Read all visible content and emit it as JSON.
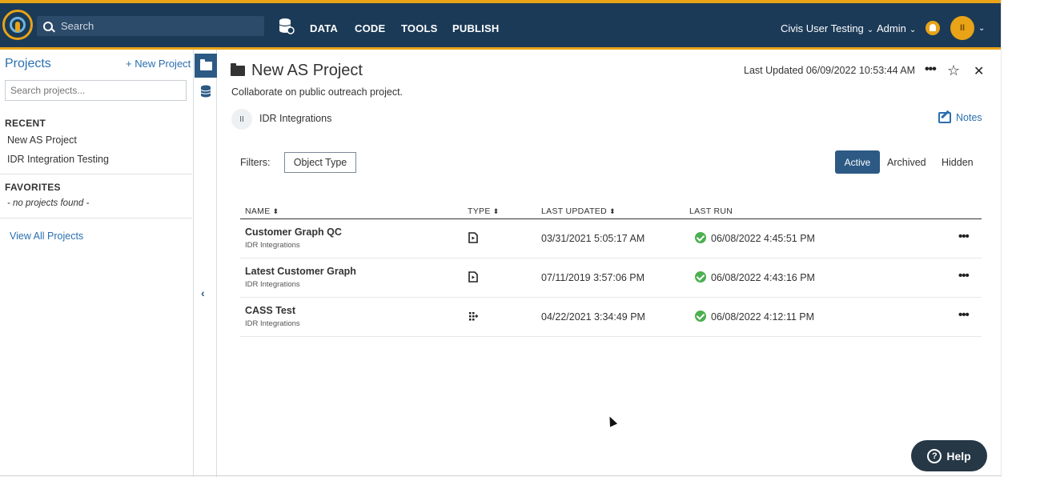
{
  "topbar": {
    "search_placeholder": "Search",
    "nav": [
      "DATA",
      "CODE",
      "TOOLS",
      "PUBLISH"
    ],
    "org_name": "Civis User Testing",
    "admin_label": "Admin",
    "avatar_initials": "II",
    "accent_color": "#e8a317",
    "bg_color": "#1b3a57"
  },
  "sidebar": {
    "title": "Projects",
    "new_project": "+ New Project",
    "search_placeholder": "Search projects...",
    "recent_heading": "RECENT",
    "recent": [
      "New AS Project",
      "IDR Integration Testing"
    ],
    "favorites_heading": "FAVORITES",
    "favorites_empty": "- no projects found -",
    "view_all": "View All Projects"
  },
  "project": {
    "title": "New AS Project",
    "description": "Collaborate on public outreach project.",
    "last_updated": "Last Updated 06/09/2022 10:53:44 AM",
    "group_initials": "II",
    "group_name": "IDR Integrations",
    "notes_label": "Notes"
  },
  "filters": {
    "label": "Filters:",
    "object_type": "Object Type",
    "tabs": [
      "Active",
      "Archived",
      "Hidden"
    ]
  },
  "table": {
    "headers": [
      "NAME",
      "TYPE",
      "LAST UPDATED",
      "LAST RUN"
    ],
    "rows": [
      {
        "name": "Customer Graph QC",
        "owner": "IDR Integrations",
        "type_icon": "report-icon",
        "updated": "03/31/2021 5:05:17 AM",
        "last_run": "06/08/2022 4:45:51 PM",
        "status": "success"
      },
      {
        "name": "Latest Customer Graph",
        "owner": "IDR Integrations",
        "type_icon": "report-icon",
        "updated": "07/11/2019 3:57:06 PM",
        "last_run": "06/08/2022 4:43:16 PM",
        "status": "success"
      },
      {
        "name": "CASS Test",
        "owner": "IDR Integrations",
        "type_icon": "workflow-icon",
        "updated": "04/22/2021 3:34:49 PM",
        "last_run": "06/08/2022 4:12:11 PM",
        "status": "success"
      }
    ]
  },
  "help": {
    "label": "Help"
  }
}
